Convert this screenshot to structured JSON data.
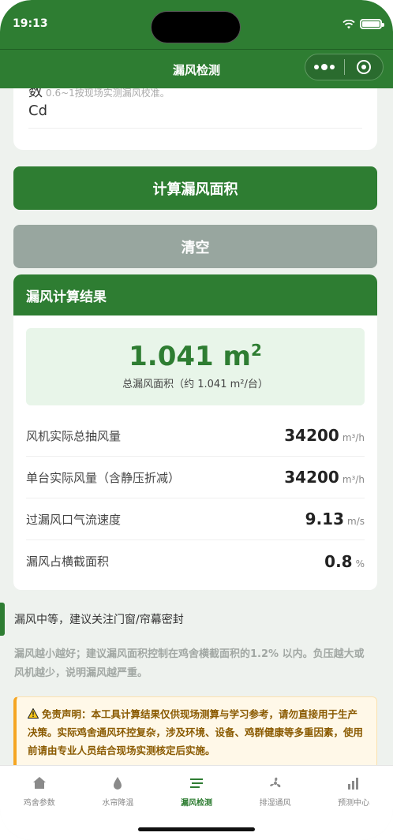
{
  "status": {
    "time": "19:13"
  },
  "nav": {
    "title": "漏风检测"
  },
  "input": {
    "label": "数",
    "hint": "0.6~1按现场实测漏风校准。",
    "unit": "Cd"
  },
  "buttons": {
    "calculate": "计算漏风面积",
    "clear": "清空"
  },
  "result": {
    "title": "漏风计算结果",
    "summary_value": "1.041 m",
    "summary_sup": "2",
    "summary_caption": "总漏风面积（约 1.041 m²/台）",
    "rows": [
      {
        "label": "风机实际总抽风量",
        "value": "34200",
        "unit": "m³/h"
      },
      {
        "label": "单台实际风量（含静压折减）",
        "value": "34200",
        "unit": "m³/h"
      },
      {
        "label": "过漏风口气流速度",
        "value": "9.13",
        "unit": "m/s"
      },
      {
        "label": "漏风占横截面积",
        "value": "0.8",
        "unit": "%"
      }
    ]
  },
  "advice": "漏风中等，建议关注门窗/帘幕密封",
  "note": "漏风越小越好；建议漏风面积控制在鸡舍横截面积的1.2% 以内。负压越大或风机越少，说明漏风越严重。",
  "disclaimer": "免责声明：本工具计算结果仅供现场测算与学习参考，请勿直接用于生产决策。实际鸡舍通风环控复杂，涉及环境、设备、鸡群健康等多重因素，使用前请由专业人员结合现场实测核定后实施。",
  "tabs": [
    {
      "label": "鸡舍参数",
      "icon": "home-icon",
      "active": false
    },
    {
      "label": "水帘降温",
      "icon": "water-drop-icon",
      "active": false
    },
    {
      "label": "漏风检测",
      "icon": "wind-lines-icon",
      "active": true
    },
    {
      "label": "排湿通风",
      "icon": "fan-icon",
      "active": false
    },
    {
      "label": "预测中心",
      "icon": "bar-chart-icon",
      "active": false
    }
  ],
  "colors": {
    "primary": "#2e7d32",
    "clear_button": "#98a69f",
    "warning": "#f5a623"
  }
}
